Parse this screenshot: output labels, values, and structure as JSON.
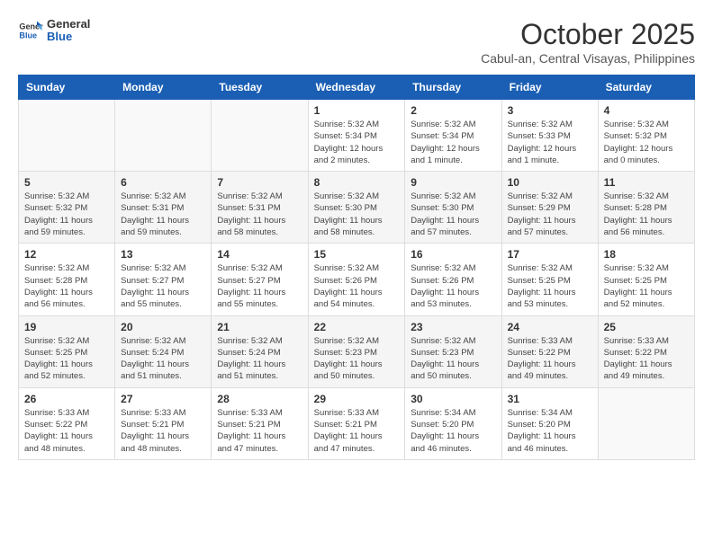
{
  "header": {
    "logo": {
      "general": "General",
      "blue": "Blue"
    },
    "title": "October 2025",
    "location": "Cabul-an, Central Visayas, Philippines"
  },
  "weekdays": [
    "Sunday",
    "Monday",
    "Tuesday",
    "Wednesday",
    "Thursday",
    "Friday",
    "Saturday"
  ],
  "weeks": [
    [
      {
        "day": "",
        "info": ""
      },
      {
        "day": "",
        "info": ""
      },
      {
        "day": "",
        "info": ""
      },
      {
        "day": "1",
        "info": "Sunrise: 5:32 AM\nSunset: 5:34 PM\nDaylight: 12 hours\nand 2 minutes."
      },
      {
        "day": "2",
        "info": "Sunrise: 5:32 AM\nSunset: 5:34 PM\nDaylight: 12 hours\nand 1 minute."
      },
      {
        "day": "3",
        "info": "Sunrise: 5:32 AM\nSunset: 5:33 PM\nDaylight: 12 hours\nand 1 minute."
      },
      {
        "day": "4",
        "info": "Sunrise: 5:32 AM\nSunset: 5:32 PM\nDaylight: 12 hours\nand 0 minutes."
      }
    ],
    [
      {
        "day": "5",
        "info": "Sunrise: 5:32 AM\nSunset: 5:32 PM\nDaylight: 11 hours\nand 59 minutes."
      },
      {
        "day": "6",
        "info": "Sunrise: 5:32 AM\nSunset: 5:31 PM\nDaylight: 11 hours\nand 59 minutes."
      },
      {
        "day": "7",
        "info": "Sunrise: 5:32 AM\nSunset: 5:31 PM\nDaylight: 11 hours\nand 58 minutes."
      },
      {
        "day": "8",
        "info": "Sunrise: 5:32 AM\nSunset: 5:30 PM\nDaylight: 11 hours\nand 58 minutes."
      },
      {
        "day": "9",
        "info": "Sunrise: 5:32 AM\nSunset: 5:30 PM\nDaylight: 11 hours\nand 57 minutes."
      },
      {
        "day": "10",
        "info": "Sunrise: 5:32 AM\nSunset: 5:29 PM\nDaylight: 11 hours\nand 57 minutes."
      },
      {
        "day": "11",
        "info": "Sunrise: 5:32 AM\nSunset: 5:28 PM\nDaylight: 11 hours\nand 56 minutes."
      }
    ],
    [
      {
        "day": "12",
        "info": "Sunrise: 5:32 AM\nSunset: 5:28 PM\nDaylight: 11 hours\nand 56 minutes."
      },
      {
        "day": "13",
        "info": "Sunrise: 5:32 AM\nSunset: 5:27 PM\nDaylight: 11 hours\nand 55 minutes."
      },
      {
        "day": "14",
        "info": "Sunrise: 5:32 AM\nSunset: 5:27 PM\nDaylight: 11 hours\nand 55 minutes."
      },
      {
        "day": "15",
        "info": "Sunrise: 5:32 AM\nSunset: 5:26 PM\nDaylight: 11 hours\nand 54 minutes."
      },
      {
        "day": "16",
        "info": "Sunrise: 5:32 AM\nSunset: 5:26 PM\nDaylight: 11 hours\nand 53 minutes."
      },
      {
        "day": "17",
        "info": "Sunrise: 5:32 AM\nSunset: 5:25 PM\nDaylight: 11 hours\nand 53 minutes."
      },
      {
        "day": "18",
        "info": "Sunrise: 5:32 AM\nSunset: 5:25 PM\nDaylight: 11 hours\nand 52 minutes."
      }
    ],
    [
      {
        "day": "19",
        "info": "Sunrise: 5:32 AM\nSunset: 5:25 PM\nDaylight: 11 hours\nand 52 minutes."
      },
      {
        "day": "20",
        "info": "Sunrise: 5:32 AM\nSunset: 5:24 PM\nDaylight: 11 hours\nand 51 minutes."
      },
      {
        "day": "21",
        "info": "Sunrise: 5:32 AM\nSunset: 5:24 PM\nDaylight: 11 hours\nand 51 minutes."
      },
      {
        "day": "22",
        "info": "Sunrise: 5:32 AM\nSunset: 5:23 PM\nDaylight: 11 hours\nand 50 minutes."
      },
      {
        "day": "23",
        "info": "Sunrise: 5:32 AM\nSunset: 5:23 PM\nDaylight: 11 hours\nand 50 minutes."
      },
      {
        "day": "24",
        "info": "Sunrise: 5:33 AM\nSunset: 5:22 PM\nDaylight: 11 hours\nand 49 minutes."
      },
      {
        "day": "25",
        "info": "Sunrise: 5:33 AM\nSunset: 5:22 PM\nDaylight: 11 hours\nand 49 minutes."
      }
    ],
    [
      {
        "day": "26",
        "info": "Sunrise: 5:33 AM\nSunset: 5:22 PM\nDaylight: 11 hours\nand 48 minutes."
      },
      {
        "day": "27",
        "info": "Sunrise: 5:33 AM\nSunset: 5:21 PM\nDaylight: 11 hours\nand 48 minutes."
      },
      {
        "day": "28",
        "info": "Sunrise: 5:33 AM\nSunset: 5:21 PM\nDaylight: 11 hours\nand 47 minutes."
      },
      {
        "day": "29",
        "info": "Sunrise: 5:33 AM\nSunset: 5:21 PM\nDaylight: 11 hours\nand 47 minutes."
      },
      {
        "day": "30",
        "info": "Sunrise: 5:34 AM\nSunset: 5:20 PM\nDaylight: 11 hours\nand 46 minutes."
      },
      {
        "day": "31",
        "info": "Sunrise: 5:34 AM\nSunset: 5:20 PM\nDaylight: 11 hours\nand 46 minutes."
      },
      {
        "day": "",
        "info": ""
      }
    ]
  ]
}
